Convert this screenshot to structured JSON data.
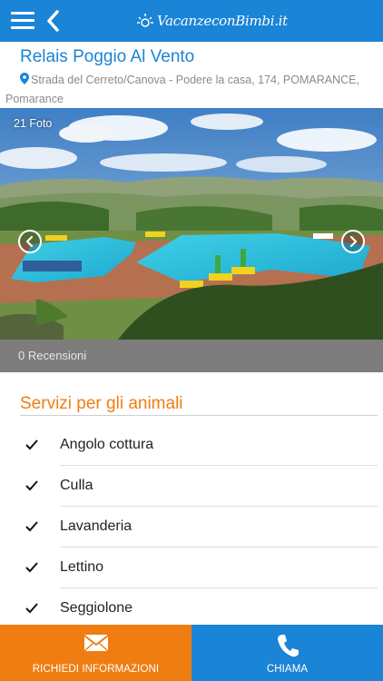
{
  "header": {
    "logo_text": "VacanzeconBimbi.it",
    "menu_icon": "hamburger-icon",
    "back_icon": "chevron-left-icon",
    "color": "#1a84d6"
  },
  "property": {
    "name": "Relais Poggio Al Vento",
    "address": "Strada del Cerreto/Canova - Podere la casa, 174, POMARANCE, Pomarance"
  },
  "gallery": {
    "photo_count": "21 Foto",
    "prev_icon": "arrow-left-circle-icon",
    "next_icon": "arrow-right-circle-icon"
  },
  "reviews": {
    "label": "0 Recensioni"
  },
  "services": {
    "title": "Servizi per gli animali",
    "items": [
      {
        "label": "Angolo cottura"
      },
      {
        "label": "Culla"
      },
      {
        "label": "Lavanderia"
      },
      {
        "label": "Lettino"
      },
      {
        "label": "Seggiolone"
      }
    ]
  },
  "actions": {
    "info_label": "RICHIEDI INFORMAZIONI",
    "info_icon": "envelope-icon",
    "info_color": "#f07d12",
    "call_label": "CHIAMA",
    "call_icon": "phone-icon",
    "call_color": "#1a84d6"
  }
}
